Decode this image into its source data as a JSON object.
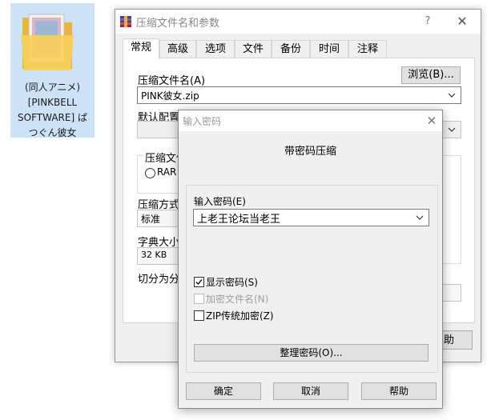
{
  "desktop": {
    "folder_label_lines": [
      "(同人アニメ)",
      "[PINKBELL",
      "SOFTWARE] ぱ",
      "つぐん彼女"
    ]
  },
  "main_window": {
    "title": "压缩文件名和参数",
    "help_icon": "?",
    "close_icon": "✕",
    "tabs": [
      "常规",
      "高级",
      "选项",
      "文件",
      "备份",
      "时间",
      "注释"
    ],
    "archive_name_label": "压缩文件名(A)",
    "browse_button": "浏览(B)...",
    "archive_name_value": "PINK彼女.zip",
    "default_profile_label": "默认配置",
    "format_label": "压缩文件",
    "format_rar": "RAR",
    "method_label": "压缩方式(",
    "method_value": "标准",
    "dict_label": "字典大小(",
    "dict_value": "32 KB",
    "split_label": "切分为分卷",
    "partial_button": "助"
  },
  "dialog": {
    "title": "输入密码",
    "close_icon": "✕",
    "heading": "带密码压缩",
    "password_label": "输入密码(E)",
    "password_value": "上老王论坛当老王",
    "show_password": "显示密码(S)",
    "show_password_checked": true,
    "encrypt_filenames": "加密文件名(N)",
    "encrypt_filenames_checked": false,
    "zip_legacy": "ZIP传统加密(Z)",
    "zip_legacy_checked": false,
    "organize_button": "整理密码(O)...",
    "ok_button": "确定",
    "cancel_button": "取消",
    "help_button": "帮助"
  },
  "colors": {
    "window_bg": "#f0f0f0",
    "desktop_selection": "#cce3f7",
    "folder_yellow": "#f5c94e"
  }
}
